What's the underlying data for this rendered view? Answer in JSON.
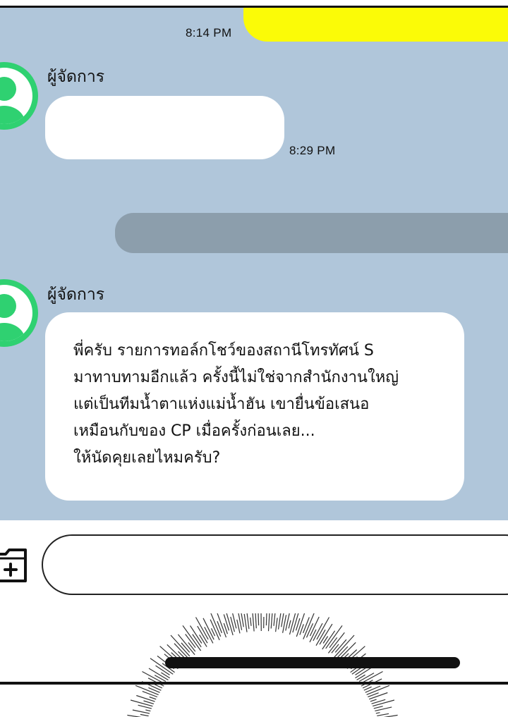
{
  "chat": {
    "messages": [
      {
        "type": "sent",
        "time": "8:14 PM",
        "text": ""
      },
      {
        "type": "received",
        "sender": "ผู้จัดการ",
        "time": "8:29 PM",
        "text": ""
      },
      {
        "type": "sent-redacted",
        "text": ""
      },
      {
        "type": "received",
        "sender": "ผู้จัดการ",
        "lines": [
          "พี่ครับ รายการทอล์กโชว์ของสถานีโทรทัศน์ S",
          "มาทาบทามอีกแล้ว ครั้งนี้ไม่ใช่จากสำนักงานใหญ่",
          "แต่เป็นทีมน้ำตาแห่งแม่น้ำฮัน เขายื่นข้อเสนอ",
          "เหมือนกับของ CP เมื่อครั้งก่อนเลย...",
          "ให้นัดคุยเลยไหมครับ?"
        ]
      }
    ]
  },
  "input_bar": {
    "attach_icon": "add-folder-icon",
    "placeholder": ""
  },
  "colors": {
    "chat_background": "#b0c6da",
    "sent_bubble": "#fbfb07",
    "received_bubble": "#ffffff",
    "redacted_bubble": "#8c9eac",
    "avatar_ring": "#2fd171"
  }
}
